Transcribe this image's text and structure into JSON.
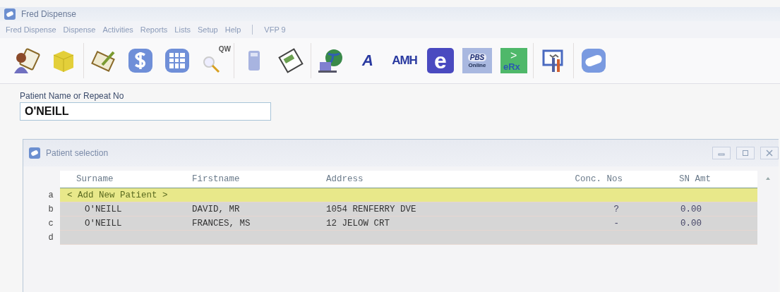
{
  "window": {
    "title": "Fred Dispense"
  },
  "menu": [
    {
      "label": "Fred Dispense"
    },
    {
      "label": "Dispense"
    },
    {
      "label": "Activities"
    },
    {
      "label": "Reports"
    },
    {
      "label": "Lists"
    },
    {
      "label": "Setup"
    },
    {
      "label": "Help"
    },
    {
      "label": "VFP 9",
      "kind": "after-separator"
    }
  ],
  "toolbar": [
    [
      {
        "kind": "person-clipboard"
      },
      {
        "kind": "box"
      }
    ],
    [
      {
        "kind": "clipboard-pen"
      },
      {
        "kind": "dollar"
      },
      {
        "kind": "grid"
      },
      {
        "kind": "search-text",
        "label": "QW"
      }
    ],
    [
      {
        "kind": "calculator"
      },
      {
        "kind": "document"
      }
    ],
    [
      {
        "kind": "globe-computer"
      },
      {
        "kind": "letter",
        "label": "A"
      },
      {
        "kind": "letter",
        "label": "AMH"
      },
      {
        "kind": "badge-e",
        "label": "e"
      },
      {
        "kind": "pbs",
        "label": "PBS",
        "sublabel": "Online"
      },
      {
        "kind": "erx",
        "label": ">",
        "sublabel": "eRx"
      }
    ],
    [
      {
        "kind": "tools"
      }
    ],
    [
      {
        "kind": "pill"
      }
    ]
  ],
  "search": {
    "label": "Patient Name or Repeat No",
    "value": "O'NEILL"
  },
  "dialog": {
    "title": "Patient selection",
    "columns": [
      "Surname",
      "Firstname",
      "Address",
      "Conc. Nos",
      "SN Amt"
    ],
    "rows": [
      {
        "letter": "a",
        "kind": "add",
        "selected": true,
        "text": "< Add New Patient >"
      },
      {
        "letter": "b",
        "kind": "patient",
        "selected": false,
        "cells": [
          "O'NEILL",
          "DAVID, MR",
          "1054 RENFERRY DVE",
          "?",
          "0.00"
        ]
      },
      {
        "letter": "c",
        "kind": "patient",
        "selected": false,
        "cells": [
          "O'NEILL",
          "FRANCES, MS",
          "12 JELOW CRT",
          "-",
          "0.00"
        ]
      },
      {
        "letter": "d",
        "kind": "empty",
        "selected": false
      }
    ]
  }
}
